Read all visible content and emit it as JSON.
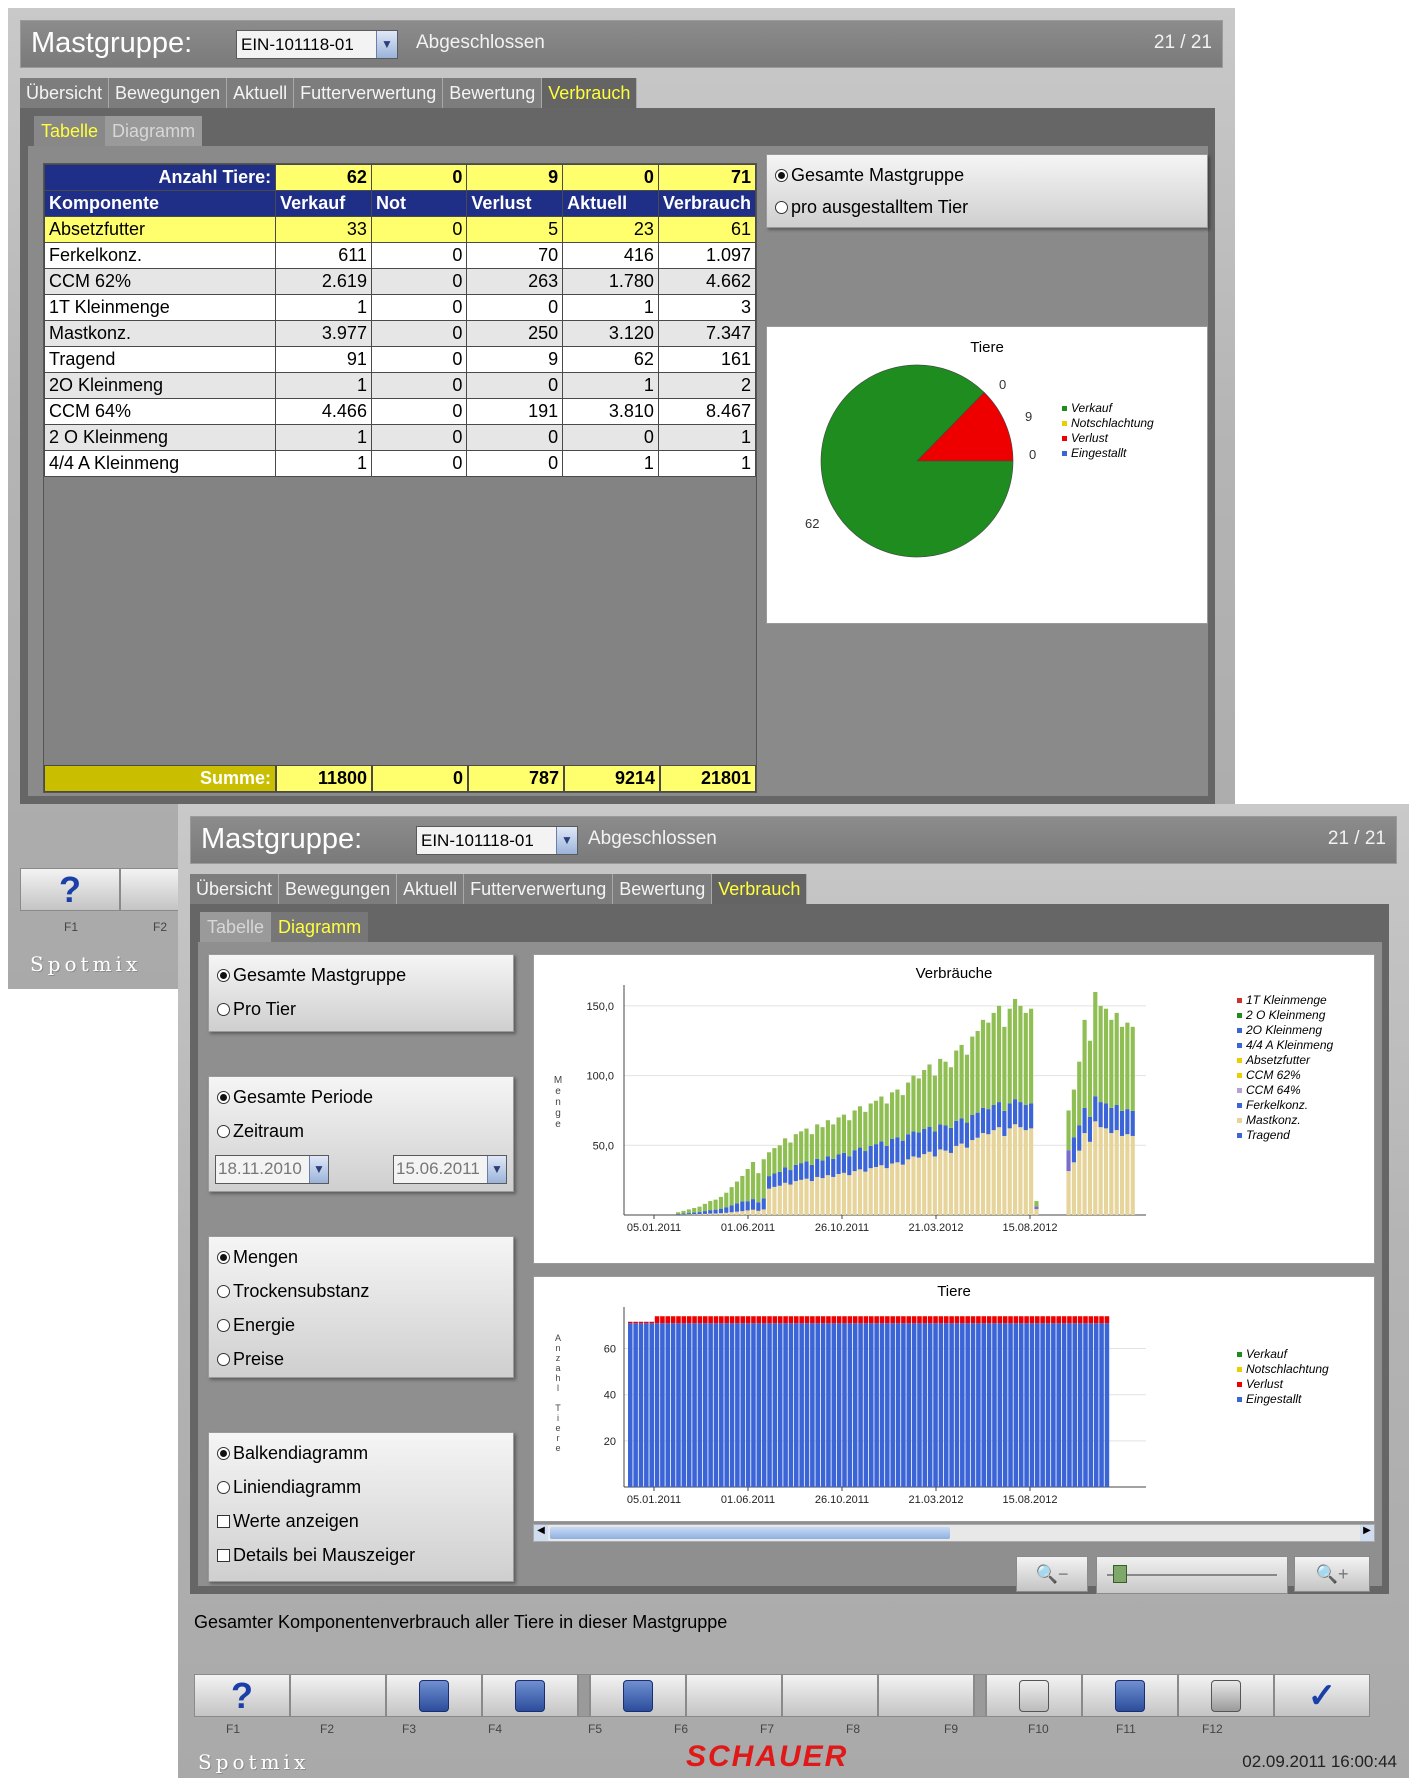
{
  "window1": {
    "title_label": "Mastgruppe:",
    "group_value": "EIN-101118-01",
    "status": "Abgeschlossen",
    "page": "21 / 21",
    "tabs": [
      "Übersicht",
      "Bewegungen",
      "Aktuell",
      "Futterverwertung",
      "Bewertung",
      "Verbrauch"
    ],
    "subtabs": [
      "Tabelle",
      "Diagramm"
    ],
    "table": {
      "count_label": "Anzahl Tiere:",
      "counts": [
        "62",
        "0",
        "9",
        "0",
        "71"
      ],
      "columns": [
        "Komponente",
        "Verkauf",
        "Not",
        "Verlust",
        "Aktuell",
        "Verbrauch"
      ],
      "rows": [
        [
          "Absetzfutter",
          "33",
          "0",
          "5",
          "23",
          "61"
        ],
        [
          "Ferkelkonz.",
          "611",
          "0",
          "70",
          "416",
          "1.097"
        ],
        [
          "CCM 62%",
          "2.619",
          "0",
          "263",
          "1.780",
          "4.662"
        ],
        [
          "1T Kleinmenge",
          "1",
          "0",
          "0",
          "1",
          "3"
        ],
        [
          "Mastkonz.",
          "3.977",
          "0",
          "250",
          "3.120",
          "7.347"
        ],
        [
          "Tragend",
          "91",
          "0",
          "9",
          "62",
          "161"
        ],
        [
          "2O Kleinmeng",
          "1",
          "0",
          "0",
          "1",
          "2"
        ],
        [
          "CCM 64%",
          "4.466",
          "0",
          "191",
          "3.810",
          "8.467"
        ],
        [
          "2 O Kleinmeng",
          "1",
          "0",
          "0",
          "0",
          "1"
        ],
        [
          "4/4 A Kleinmeng",
          "1",
          "0",
          "0",
          "1",
          "1"
        ]
      ],
      "sum_label": "Summe:",
      "sums": [
        "11800",
        "0",
        "787",
        "9214",
        "21801"
      ]
    },
    "options": [
      "Gesamte Mastgruppe",
      "pro ausgestalltem Tier"
    ],
    "pie": {
      "title": "Tiere",
      "labels": [
        "0",
        "9",
        "0",
        "62"
      ],
      "legend": [
        "Verkauf",
        "Notschlachtung",
        "Verlust",
        "Eingestallt"
      ]
    },
    "fkeys": [
      "F1",
      "F2"
    ],
    "brand": "Spotmix"
  },
  "window2": {
    "title_label": "Mastgruppe:",
    "group_value": "EIN-101118-01",
    "status": "Abgeschlossen",
    "page": "21 / 21",
    "tabs": [
      "Übersicht",
      "Bewegungen",
      "Aktuell",
      "Futterverwertung",
      "Bewertung",
      "Verbrauch"
    ],
    "subtabs": [
      "Tabelle",
      "Diagramm"
    ],
    "group1": [
      "Gesamte Mastgruppe",
      "Pro Tier"
    ],
    "group2": [
      "Gesamte Periode",
      "Zeitraum"
    ],
    "date_from": "18.11.2010",
    "date_to": "15.06.2011",
    "group3": [
      "Mengen",
      "Trockensubstanz",
      "Energie",
      "Preise"
    ],
    "group4": [
      "Balkendiagramm",
      "Liniendiagramm"
    ],
    "checks": [
      "Werte anzeigen",
      "Details bei Mauszeiger"
    ],
    "footer_text": "Gesamter Komponentenverbrauch aller Tiere in dieser Mastgruppe",
    "fkeys": [
      "F1",
      "F2",
      "F3",
      "F4",
      "F5",
      "F6",
      "F7",
      "F8",
      "F9",
      "F10",
      "F11",
      "F12"
    ],
    "brand": "Spotmix",
    "logo": "SCHAUER",
    "datetime": "02.09.2011 16:00:44"
  },
  "colors": {
    "verkauf": "#1e8c1e",
    "notschlachtung": "#e8d000",
    "verlust": "#ee0000",
    "eingestallt": "#3b64d6",
    "kleinmenge": "#d03030",
    "absetz": "#e08a30",
    "green_feed": "#8fbf52",
    "tan_feed": "#e6d49a",
    "purple": "#7a6ccc"
  },
  "chart_data": [
    {
      "type": "pie",
      "title": "Tiere",
      "categories": [
        "Verkauf",
        "Notschlachtung",
        "Verlust",
        "Eingestallt"
      ],
      "values": [
        62,
        0,
        9,
        0
      ]
    },
    {
      "type": "bar",
      "title": "Verbräuche",
      "ylabel": "Menge",
      "x_ticks": [
        "05.01.2011",
        "01.06.2011",
        "26.10.2011",
        "21.03.2012",
        "15.08.2012"
      ],
      "y_ticks": [
        "50,0",
        "100,0",
        "150,0"
      ],
      "ylim": [
        0,
        165
      ],
      "stacked": true,
      "legend": [
        "1T Kleinmenge",
        "2 O Kleinmeng",
        "2O Kleinmeng",
        "4/4 A Kleinmeng",
        "Absetzfutter",
        "CCM 62%",
        "CCM 64%",
        "Ferkelkonz.",
        "Mastkonz.",
        "Tragend"
      ],
      "totals_profile": [
        0,
        0,
        0,
        0,
        0,
        0,
        2,
        3,
        4,
        5,
        6,
        8,
        10,
        11,
        13,
        16,
        20,
        24,
        28,
        33,
        38,
        30,
        40,
        45,
        48,
        50,
        55,
        52,
        58,
        60,
        62,
        58,
        65,
        63,
        68,
        65,
        70,
        72,
        68,
        75,
        78,
        74,
        80,
        82,
        85,
        80,
        88,
        90,
        86,
        95,
        100,
        98,
        104,
        108,
        100,
        112,
        110,
        106,
        118,
        122,
        115,
        128,
        132,
        140,
        138,
        145,
        150,
        135,
        148,
        155,
        150,
        145,
        148,
        10,
        0,
        0,
        0,
        0,
        0,
        75,
        90,
        110,
        140,
        125,
        160,
        150,
        148,
        140,
        145,
        135,
        138,
        135
      ]
    },
    {
      "type": "bar",
      "title": "Tiere",
      "ylabel": "Anzahl Tiere",
      "x_ticks": [
        "05.01.2011",
        "01.06.2011",
        "26.10.2011",
        "21.03.2012",
        "15.08.2012"
      ],
      "y_ticks": [
        "20",
        "40",
        "60"
      ],
      "ylim": [
        0,
        78
      ],
      "stacked": true,
      "series": [
        {
          "name": "Eingestallt",
          "value_approx": 71
        },
        {
          "name": "Verlust",
          "value_approx": 3
        }
      ],
      "legend": [
        "Verkauf",
        "Notschlachtung",
        "Verlust",
        "Eingestallt"
      ]
    }
  ]
}
